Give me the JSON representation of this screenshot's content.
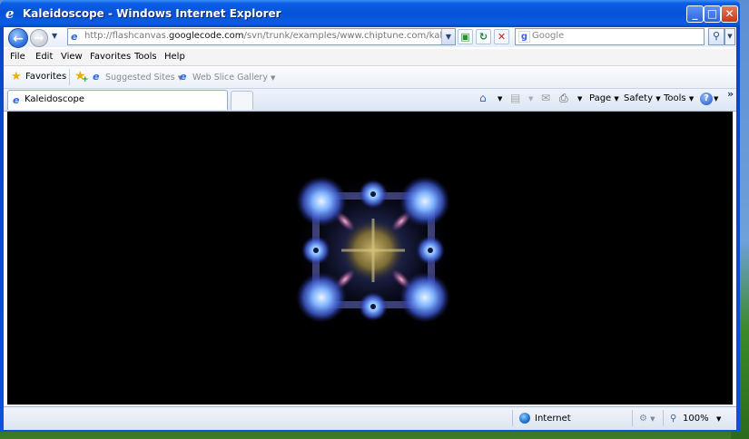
{
  "window": {
    "title": "Kaleidoscope - Windows Internet Explorer",
    "controls": {
      "minimize": "_",
      "maximize": "□",
      "close": "✕"
    }
  },
  "navigation": {
    "address": {
      "prefix": "http://flashcanvas.",
      "highlight": "googlecode.com",
      "suffix": "/svn/trunk/examples/www.chiptune.com/kaleidoscope/index.htm"
    },
    "search_placeholder": "Google"
  },
  "menu": [
    "File",
    "Edit",
    "View",
    "Favorites",
    "Tools",
    "Help"
  ],
  "favorites_bar": {
    "favorites_label": "Favorites",
    "links": [
      "Suggested Sites",
      "Web Slice Gallery"
    ]
  },
  "tab": {
    "label": "Kaleidoscope"
  },
  "command_bar": {
    "page": "Page",
    "safety": "Safety",
    "tools": "Tools"
  },
  "status_bar": {
    "zone": "Internet",
    "zoom": "100%"
  },
  "colors": {
    "titlebar": "#0653d6",
    "content_bg": "#000000",
    "accent_blue": "#2b6ad9"
  },
  "icons": [
    "ie-logo-icon",
    "back-arrow-icon",
    "forward-arrow-icon",
    "refresh-icon",
    "stop-icon",
    "compatibility-icon",
    "search-icon",
    "star-icon",
    "add-favorite-icon",
    "home-icon",
    "feeds-icon",
    "mail-icon",
    "print-icon",
    "help-icon",
    "globe-icon",
    "protected-mode-icon",
    "zoom-icon"
  ]
}
